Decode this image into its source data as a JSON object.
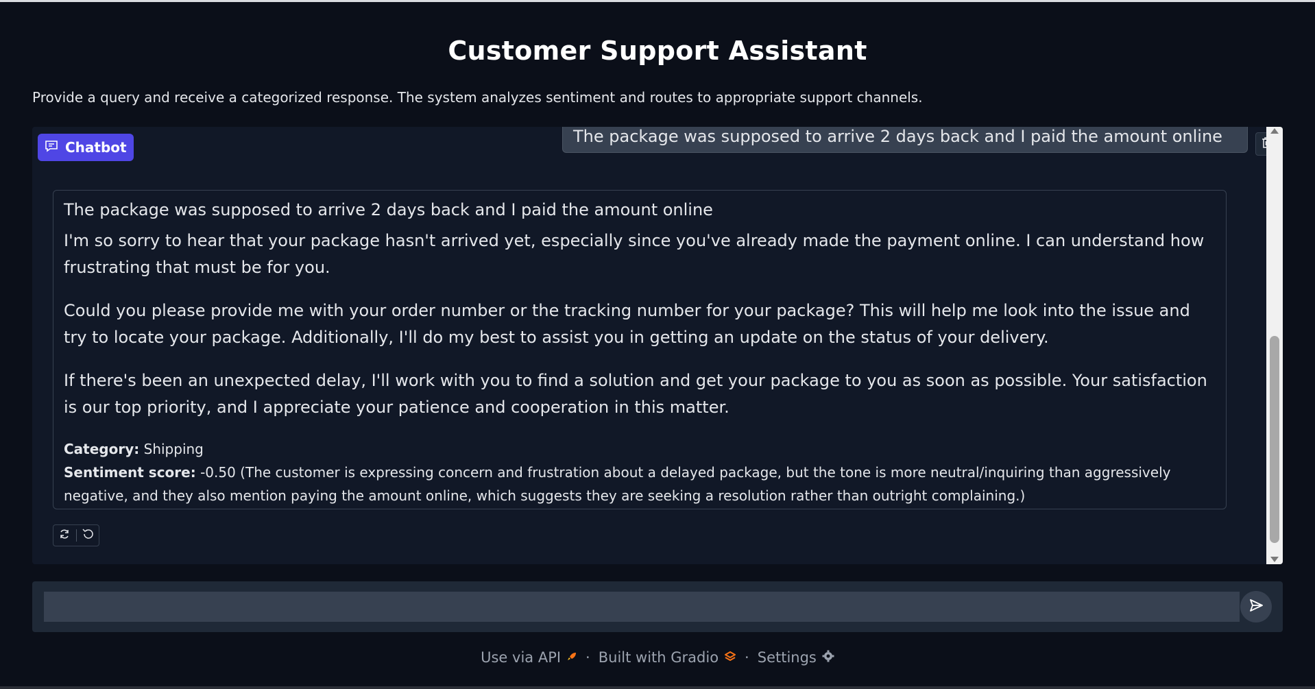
{
  "app": {
    "title": "Customer Support Assistant",
    "description": "Provide a query and receive a categorized response. The system analyzes sentiment and routes to appropriate support channels."
  },
  "chatbot": {
    "label": "Chatbot",
    "user_message": "The package was supposed to arrive 2 days back and I paid the amount online",
    "bot_echo": "The package was supposed to arrive 2 days back and I paid the amount online",
    "bot_paragraphs": [
      "I'm so sorry to hear that your package hasn't arrived yet, especially since you've already made the payment online. I can understand how frustrating that must be for you.",
      "Could you please provide me with your order number or the tracking number for your package? This will help me look into the issue and try to locate your package. Additionally, I'll do my best to assist you in getting an update on the status of your delivery.",
      "If there's been an unexpected delay, I'll work with you to find a solution and get your package to you as soon as possible. Your satisfaction is our top priority, and I appreciate your patience and cooperation in this matter."
    ],
    "category_label": "Category:",
    "category_value": "Shipping",
    "sentiment_label": "Sentiment score:",
    "sentiment_value": "-0.50 (The customer is expressing concern and frustration about a delayed package, but the tone is more neutral/inquiring than aggressively negative, and they also mention paying the amount online, which suggests they are seeking a resolution rather than outright complaining.)",
    "icons": {
      "label": "chat-icon",
      "clear": "trash-icon",
      "retry": "retry-icon",
      "undo": "undo-icon"
    }
  },
  "input": {
    "value": "",
    "placeholder": "",
    "send_icon": "send-icon"
  },
  "footer": {
    "api_label": "Use via API",
    "gradio_label": "Built with Gradio",
    "settings_label": "Settings",
    "separator": "·"
  },
  "colors": {
    "background": "#0b0f19",
    "panel": "#111827",
    "accent": "#4f46e5",
    "bubble": "#374151"
  }
}
